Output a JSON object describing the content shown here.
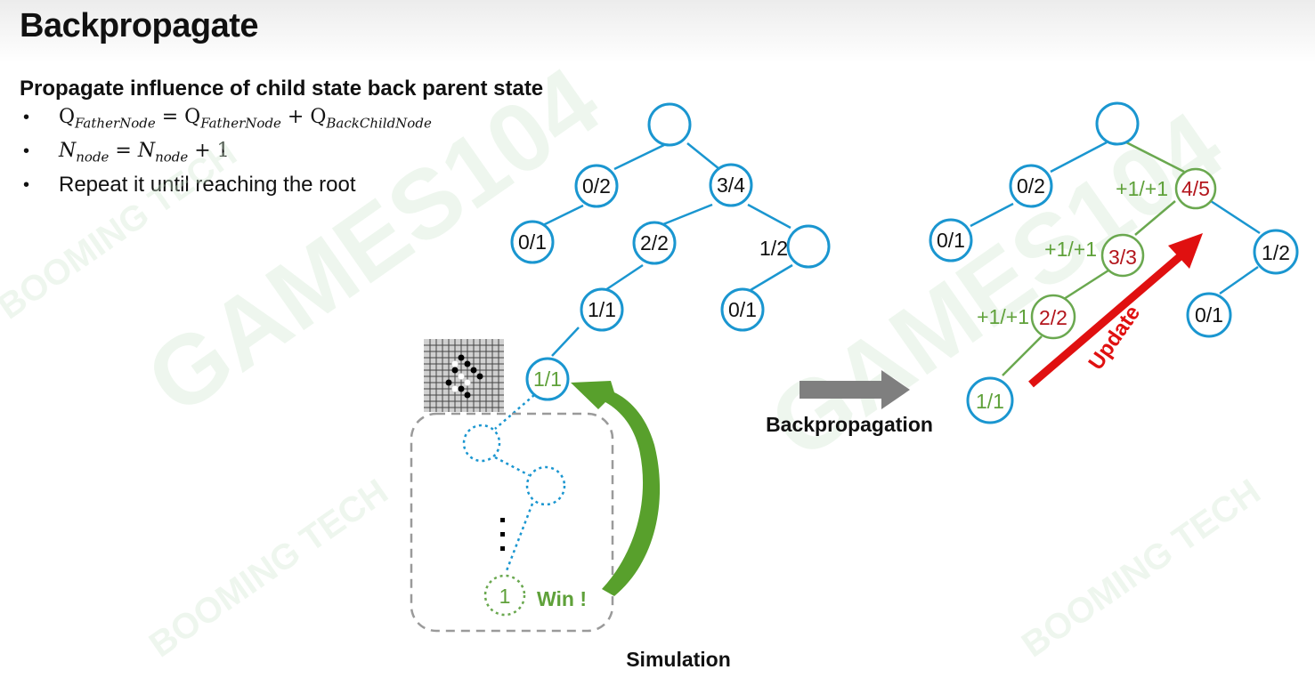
{
  "title": "Backpropagate",
  "subtitle": "Propagate influence of child state back parent state",
  "bullets": {
    "b1": {
      "q": "Q",
      "sub_father": "FatherNode",
      "eq": " = ",
      "plus": " + ",
      "sub_child": "BackChildNode"
    },
    "b2": {
      "n": "N",
      "sub_node": "node",
      "eq": " = ",
      "plus_one": " + 1"
    },
    "b3": "Repeat it until reaching the root",
    "marker": "•"
  },
  "left_tree": {
    "labels": {
      "n_l1_left": "0/2",
      "n_l1_right": "3/4",
      "n_l2_a": "0/1",
      "n_l2_b": "2/2",
      "n_l2_c": "1/2",
      "n_l3_a": "1/1",
      "n_l3_b": "0/1",
      "n_l4": "1/1"
    },
    "simulation_node": "1",
    "win": "Win !",
    "simulation_label": "Simulation"
  },
  "arrow_label": "Backpropagation",
  "right_tree": {
    "labels": {
      "n_l1_left": "0/2",
      "n_l1_right": "4/5",
      "n_l2_a": "0/1",
      "n_l2_b": "3/3",
      "n_l2_c": "1/2",
      "n_l3_a": "2/2",
      "n_l3_b": "0/1",
      "n_l4": "1/1"
    },
    "increments": {
      "inc_l1": "+1/+1",
      "inc_l2": "+1/+1",
      "inc_l3": "+1/+1"
    },
    "update": "Update"
  },
  "watermarks": [
    "GAMES104",
    "BOOMING TECH"
  ],
  "colors": {
    "node_blue": "#1a96d0",
    "path_green": "#6aa84f",
    "update_red": "#e01010",
    "arrow_gray": "#7f7f7f",
    "value_red": "#b3151c"
  }
}
